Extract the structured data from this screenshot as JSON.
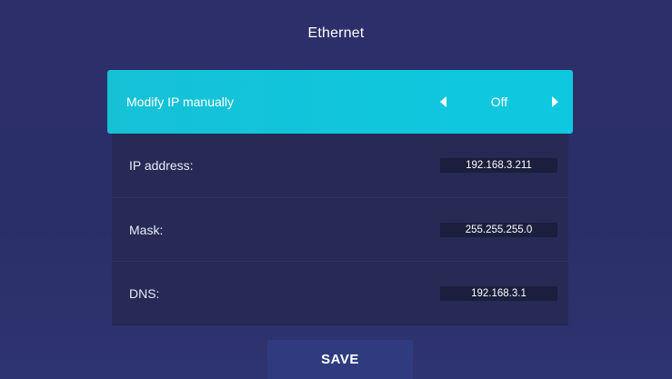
{
  "header": {
    "title": "Ethernet"
  },
  "ip_mode": {
    "label": "Modify IP manually",
    "value": "Off",
    "prev_icon": "left-triangle-icon",
    "next_icon": "right-triangle-icon"
  },
  "fields": {
    "ip_address": {
      "label": "IP address:",
      "value": "192.168.3.211"
    },
    "mask": {
      "label": "Mask:",
      "value": "255.255.255.0"
    },
    "dns": {
      "label": "DNS:",
      "value": "192.168.3.1"
    }
  },
  "actions": {
    "save_label": "SAVE"
  },
  "colors": {
    "background": "#2c2f6a",
    "accent": "#10c6dd",
    "row": "#262a55",
    "value_box": "#1b1e3c",
    "save_button": "#2f3b7e"
  }
}
